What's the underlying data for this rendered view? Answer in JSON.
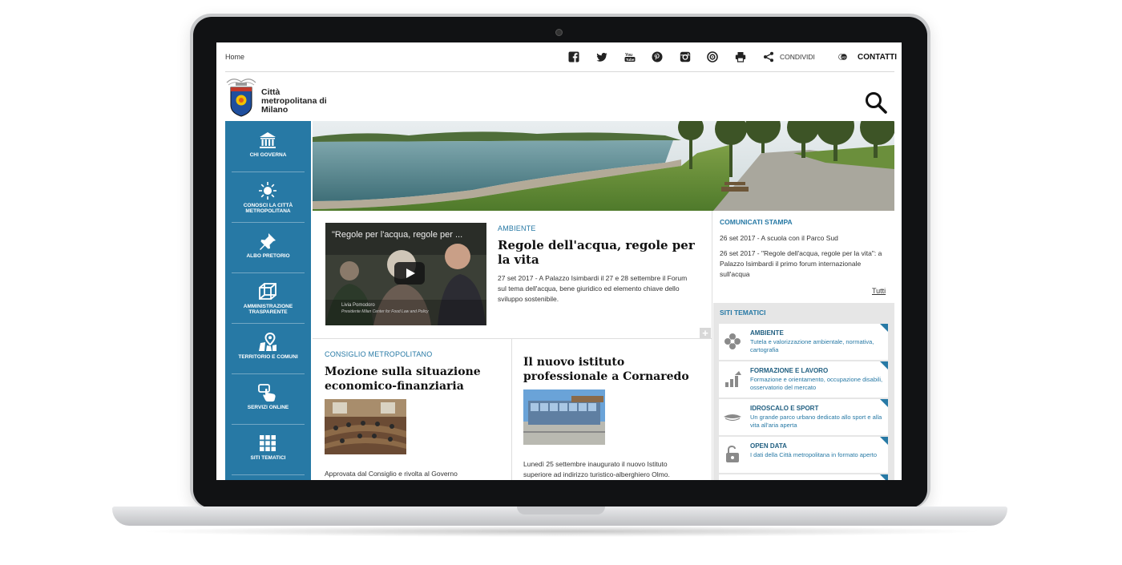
{
  "topbar": {
    "breadcrumb": "Home",
    "share_label": "CONDIVIDI",
    "contact_label": "CONTATTI",
    "social_icons": [
      "facebook-icon",
      "twitter-icon",
      "youtube-icon",
      "pinterest-icon",
      "instagram-icon",
      "flickr-icon",
      "print-icon",
      "share-icon"
    ]
  },
  "logo": {
    "text": "Città metropolitana di Milano"
  },
  "colors": {
    "accent": "#2779a5",
    "nav_bg": "#2779a5"
  },
  "nav": {
    "items": [
      {
        "label": "CHI GOVERNA",
        "icon": "institution-icon"
      },
      {
        "label": "CONOSCI LA CITTÀ METROPOLITANA",
        "icon": "sun-icon"
      },
      {
        "label": "ALBO PRETORIO",
        "icon": "pin-icon"
      },
      {
        "label": "AMMINISTRAZIONE TRASPARENTE",
        "icon": "cube-icon"
      },
      {
        "label": "TERRITORIO E COMUNI",
        "icon": "map-marker-icon"
      },
      {
        "label": "SERVIZI ONLINE",
        "icon": "hand-pointer-icon"
      },
      {
        "label": "SITI TEMATICI",
        "icon": "grid-icon"
      }
    ]
  },
  "lead": {
    "video_title": "\"Regole per l'acqua, regole per ...",
    "video_caption": "Livia Pomodoro",
    "video_subcaption": "Presidente Milan Center for Food Law and Policy",
    "category": "AMBIENTE",
    "title": "Regole dell'acqua, regole per la vita",
    "body": "27 set 2017 - A Palazzo Isimbardi il 27 e 28 settembre il Forum sul tema dell'acqua, bene giuridico ed elemento chiave dello sviluppo sostenibile."
  },
  "cards": [
    {
      "category": "CONSIGLIO METROPOLITANO",
      "title": "Mozione sulla situazione economico-finanziaria",
      "body": "Approvata dal Consiglio e rivolta al Governo"
    },
    {
      "category": "",
      "title": "Il nuovo istituto professionale a Cornaredo",
      "body": "Lunedì 25 settembre inaugurato il nuovo Istituto superiore ad indirizzo turistico-alberghiero Olmo."
    }
  ],
  "press": {
    "heading": "COMUNICATI STAMPA",
    "items": [
      "26 set 2017 - A scuola con il Parco Sud",
      "26 set 2017 - \"Regole dell'acqua, regole per la vita\": a Palazzo Isimbardi il primo forum internazionale sull'acqua"
    ],
    "more_label": "Tutti"
  },
  "sites": {
    "heading": "SITI TEMATICI",
    "items": [
      {
        "name": "AMBIENTE",
        "desc": "Tutela e valorizzazione ambientale, normativa, cartografia",
        "icon": "flower-icon"
      },
      {
        "name": "FORMAZIONE E LAVORO",
        "desc": "Formazione e orientamento, occupazione disabili, osservatorio del mercato",
        "icon": "growth-chart-icon"
      },
      {
        "name": "IDROSCALO E SPORT",
        "desc": "Un grande parco urbano dedicato allo sport e alla vita all'aria aperta",
        "icon": "boat-icon"
      },
      {
        "name": "OPEN DATA",
        "desc": "I dati della Città metropolitana in formato aperto",
        "icon": "open-lock-icon"
      }
    ]
  }
}
